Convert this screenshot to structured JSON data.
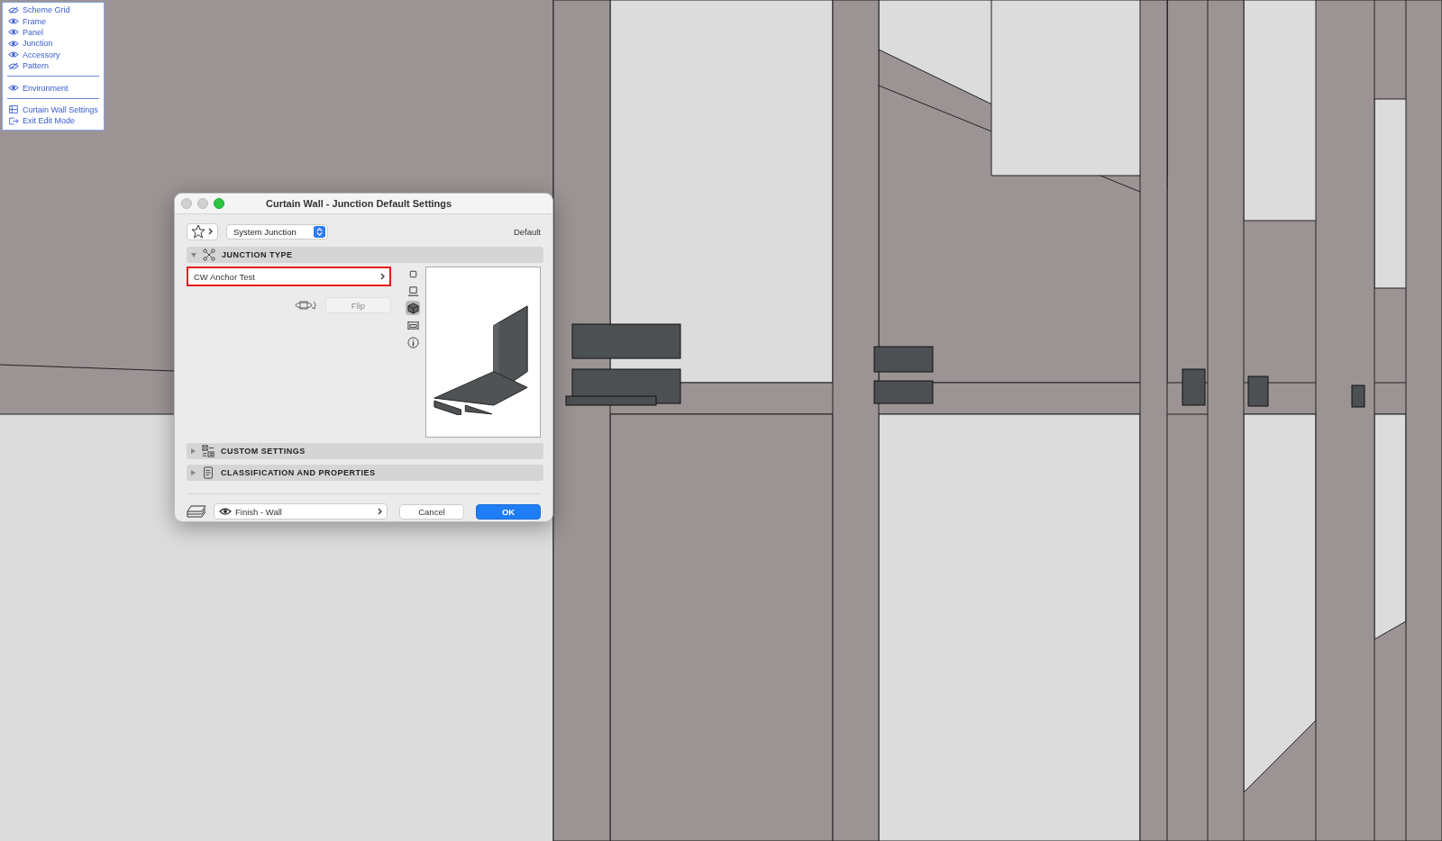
{
  "palette": {
    "visibility_items": [
      {
        "label": "Scheme Grid",
        "visible": false
      },
      {
        "label": "Frame",
        "visible": true
      },
      {
        "label": "Panel",
        "visible": true
      },
      {
        "label": "Junction",
        "visible": true
      },
      {
        "label": "Accessory",
        "visible": true
      },
      {
        "label": "Pattern",
        "visible": false
      }
    ],
    "environment": {
      "label": "Environment",
      "visible": true
    },
    "commands": [
      {
        "label": "Curtain Wall Settings",
        "kind": "settings"
      },
      {
        "label": "Exit Edit Mode",
        "kind": "exit"
      }
    ]
  },
  "dialog": {
    "title": "Curtain Wall - Junction Default Settings",
    "type_selector": "System Junction",
    "default_label": "Default",
    "sections": [
      {
        "title": "JUNCTION TYPE",
        "kind": "junction",
        "expanded": true
      },
      {
        "title": "CUSTOM SETTINGS",
        "kind": "custom",
        "expanded": false
      },
      {
        "title": "CLASSIFICATION AND PROPERTIES",
        "kind": "classification",
        "expanded": false
      }
    ],
    "junction_name": "CW Anchor Test",
    "flip": {
      "label": "Flip",
      "disabled": true
    },
    "view_buttons": [
      {
        "kind": "plan",
        "selected": false
      },
      {
        "kind": "section",
        "selected": false
      },
      {
        "kind": "perspective",
        "selected": true
      },
      {
        "kind": "elevation",
        "selected": false
      },
      {
        "kind": "info",
        "selected": false
      }
    ],
    "layer": "Finish - Wall",
    "buttons": [
      {
        "label": "Cancel",
        "kind": "secondary"
      },
      {
        "label": "OK",
        "kind": "primary"
      }
    ]
  }
}
